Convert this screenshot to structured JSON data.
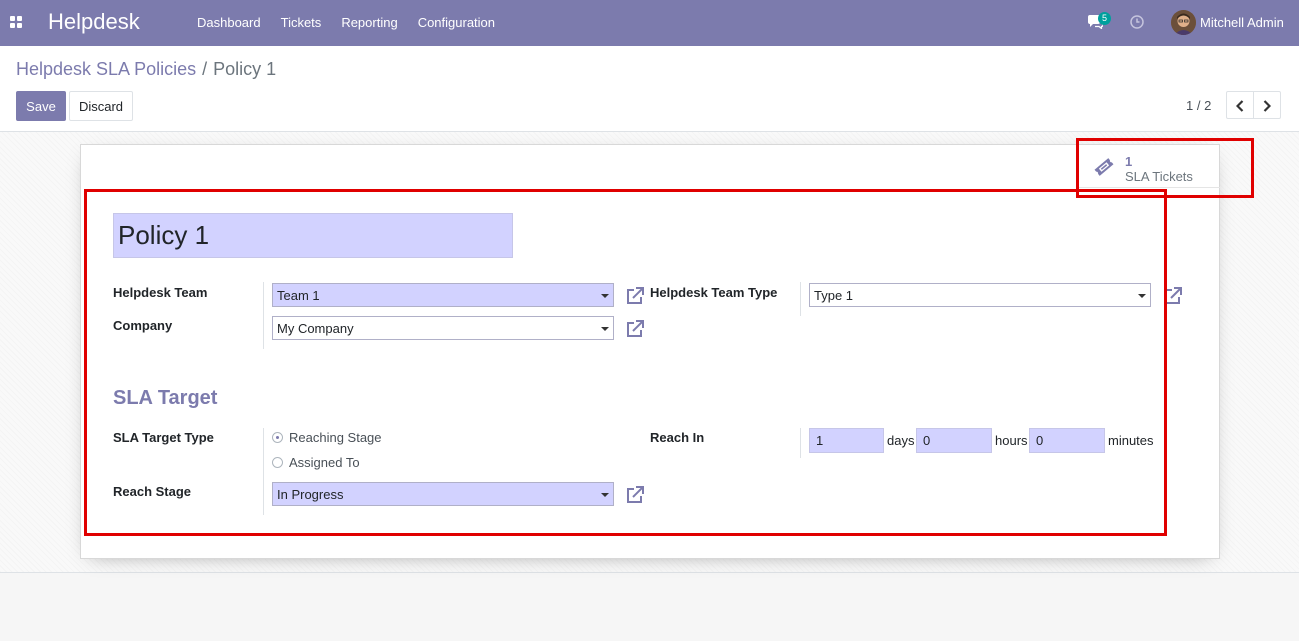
{
  "navbar": {
    "brand": "Helpdesk",
    "menu": [
      "Dashboard",
      "Tickets",
      "Reporting",
      "Configuration"
    ],
    "chat_count": "5",
    "user_name": "Mitchell Admin"
  },
  "breadcrumb": {
    "parent": "Helpdesk SLA Policies",
    "separator": "/",
    "current": "Policy 1"
  },
  "toolbar": {
    "save_label": "Save",
    "discard_label": "Discard"
  },
  "pager": {
    "value": "1 / 2"
  },
  "stat_button": {
    "value": "1",
    "label": "SLA Tickets"
  },
  "form": {
    "name": "Policy 1",
    "helpdesk_team_label": "Helpdesk Team",
    "helpdesk_team_value": "Team 1",
    "company_label": "Company",
    "company_value": "My Company",
    "team_type_label": "Helpdesk Team Type",
    "team_type_value": "Type 1",
    "sla_section_title": "SLA Target",
    "sla_target_type_label": "SLA Target Type",
    "sla_target_type_options": [
      "Reaching Stage",
      "Assigned To"
    ],
    "sla_target_type_selected": "Reaching Stage",
    "reach_stage_label": "Reach Stage",
    "reach_stage_value": "In Progress",
    "reach_in_label": "Reach In",
    "reach_in_days": "1",
    "reach_in_days_unit": "days",
    "reach_in_hours": "0",
    "reach_in_hours_unit": "hours",
    "reach_in_minutes": "0",
    "reach_in_minutes_unit": "minutes"
  },
  "colors": {
    "primary": "#7c7bad",
    "required_field": "#d2d2ff",
    "highlight": "#e00000",
    "badge": "#00a09d"
  }
}
